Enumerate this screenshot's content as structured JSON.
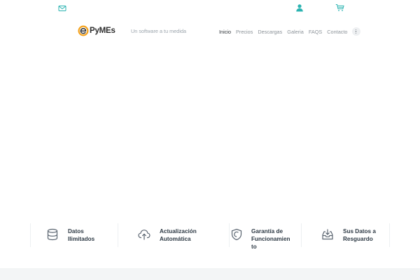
{
  "topbar": {
    "icons": [
      "mail-icon",
      "user-icon",
      "cart-icon"
    ]
  },
  "header": {
    "logo_text": "PyMEs",
    "tagline": "Un software a tu medida",
    "nav": [
      {
        "label": "Inicio",
        "active": true
      },
      {
        "label": "Precios",
        "active": false
      },
      {
        "label": "Descargas",
        "active": false
      },
      {
        "label": "Galeria",
        "active": false
      },
      {
        "label": "FAQS",
        "active": false
      },
      {
        "label": "Contacto",
        "active": false
      }
    ]
  },
  "features": [
    {
      "icon": "database-icon",
      "line1": "Datos",
      "line2": "Ilimitados",
      "line3": ""
    },
    {
      "icon": "cloud-upload-icon",
      "line1": "Actualización",
      "line2": "Automática",
      "line3": ""
    },
    {
      "icon": "shield-icon",
      "line1": "Garantía de",
      "line2": "Funcionamien",
      "line3": "to"
    },
    {
      "icon": "inbox-download-icon",
      "line1": "Sus Datos a",
      "line2": "Resguardo",
      "line3": ""
    }
  ],
  "colors": {
    "accent": "#2bb3b1",
    "logo_orange": "#f5a21b",
    "text_dark": "#2e3a45",
    "text_muted": "#8c9399",
    "icon_gray": "#5a6470"
  }
}
